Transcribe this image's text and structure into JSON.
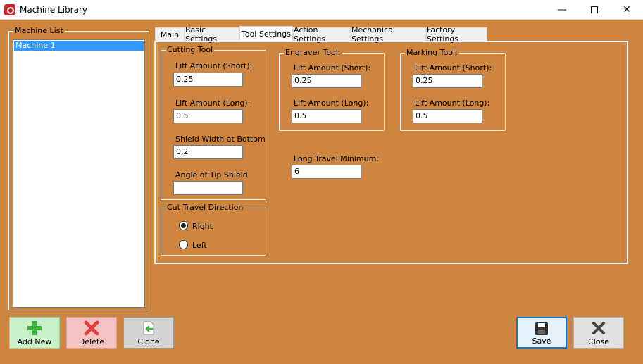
{
  "window": {
    "title": "Machine Library",
    "minimize_glyph": "—",
    "close_glyph": "✕"
  },
  "machine_list": {
    "label": "Machine List",
    "items": [
      "Machine 1"
    ]
  },
  "tabs": [
    {
      "label": "Main"
    },
    {
      "label": "Basic Settings"
    },
    {
      "label": "Tool Settings",
      "active": true
    },
    {
      "label": "Action Settings"
    },
    {
      "label": "Mechanical Settings"
    },
    {
      "label": "Factory Settings"
    }
  ],
  "cutting_tool": {
    "title": "Cutting Tool",
    "lift_short_label": "Lift Amount (Short):",
    "lift_short_value": "0.25",
    "lift_long_label": "Lift Amount (Long):",
    "lift_long_value": "0.5",
    "shield_width_label": "Shield Width at Bottom",
    "shield_width_value": "0.2",
    "tip_angle_label": "Angle of Tip Shield",
    "tip_angle_value": ""
  },
  "engraver_tool": {
    "title": "Engraver Tool:",
    "lift_short_label": "Lift Amount (Short):",
    "lift_short_value": "0.25",
    "lift_long_label": "Lift Amount (Long):",
    "lift_long_value": "0.5"
  },
  "marking_tool": {
    "title": "Marking Tool:",
    "lift_short_label": "Lift Amount (Short):",
    "lift_short_value": "0.25",
    "lift_long_label": "Lift Amount (Long):",
    "lift_long_value": "0.5"
  },
  "long_travel": {
    "label": "Long Travel Minimum:",
    "value": "6"
  },
  "cut_travel": {
    "title": "Cut Travel Direction",
    "options": [
      "Right",
      "Left"
    ],
    "selected": "Right"
  },
  "buttons": {
    "add_new": "Add New",
    "delete": "Delete",
    "clone": "Clone",
    "save": "Save",
    "close": "Close"
  },
  "colors": {
    "background": "#cd853f",
    "selection": "#3399ff",
    "add_green": "#3cb43c",
    "delete_red": "#e04040"
  }
}
